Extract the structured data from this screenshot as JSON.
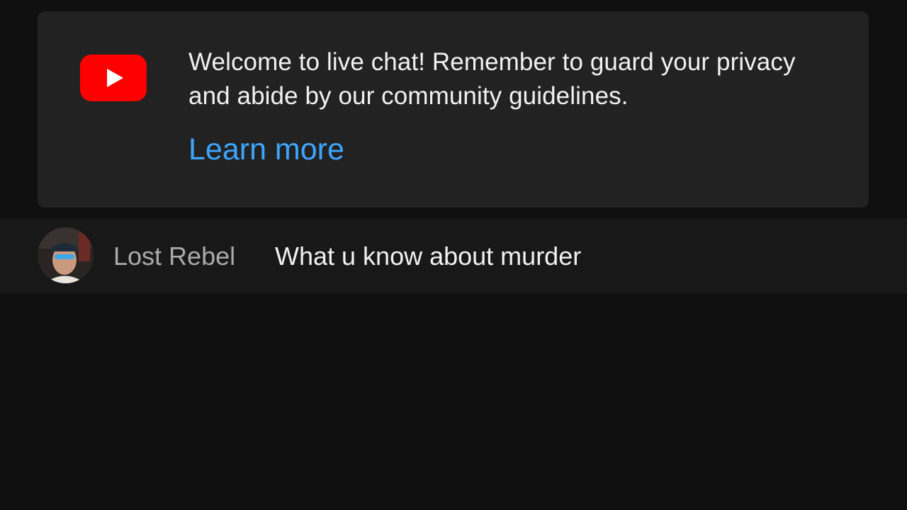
{
  "welcome": {
    "message": "Welcome to live chat! Remember to guard your privacy and abide by our community guidelines.",
    "link_label": "Learn more",
    "logo_icon": "youtube-logo-icon"
  },
  "chat": {
    "messages": [
      {
        "author": "Lost Rebel",
        "text": "What u know about murder",
        "avatar_icon": "user-avatar"
      }
    ]
  },
  "colors": {
    "background": "#0f0f0f",
    "card": "#222222",
    "row_highlight": "#181818",
    "text": "#f1f1f1",
    "author": "#aaaaaa",
    "link": "#3ea6ff",
    "brand_red": "#ff0000"
  }
}
